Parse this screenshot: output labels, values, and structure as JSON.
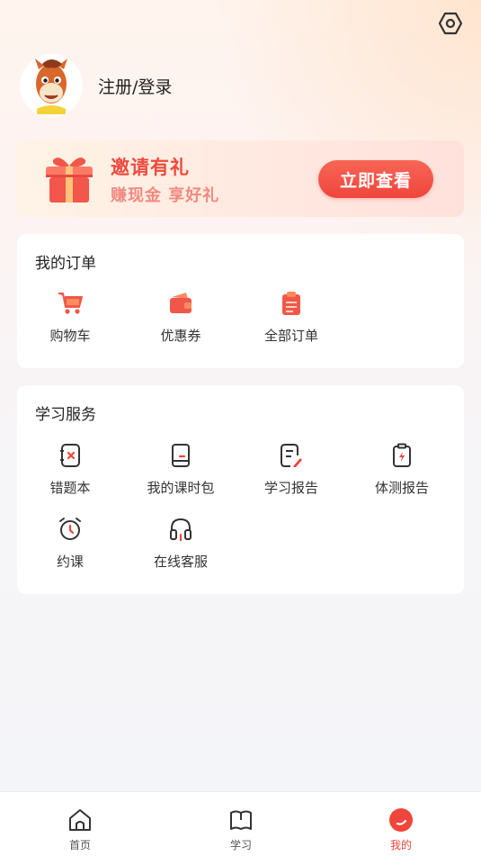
{
  "header": {
    "settings_icon": "settings-hexagon-icon"
  },
  "profile": {
    "login_label": "注册/登录",
    "avatar_icon": "horse-mascot-avatar"
  },
  "banner": {
    "title": "邀请有礼",
    "subtitle": "赚现金 享好礼",
    "cta_label": "立即查看",
    "icon": "gift-box-icon",
    "accent": "#ef4a3e"
  },
  "orders": {
    "title": "我的订单",
    "items": [
      {
        "label": "购物车",
        "icon": "shopping-cart-icon"
      },
      {
        "label": "优惠券",
        "icon": "coupon-wallet-icon"
      },
      {
        "label": "全部订单",
        "icon": "order-list-icon"
      }
    ]
  },
  "services": {
    "title": "学习服务",
    "items": [
      {
        "label": "错题本",
        "icon": "mistake-book-icon"
      },
      {
        "label": "我的课时包",
        "icon": "lesson-package-icon"
      },
      {
        "label": "学习报告",
        "icon": "study-report-icon"
      },
      {
        "label": "体测报告",
        "icon": "fitness-report-icon"
      },
      {
        "label": "约课",
        "icon": "alarm-clock-icon"
      },
      {
        "label": "在线客服",
        "icon": "headset-icon"
      }
    ]
  },
  "tabbar": {
    "active_color": "#ef453a",
    "tabs": [
      {
        "label": "首页",
        "icon": "home-icon"
      },
      {
        "label": "学习",
        "icon": "book-icon"
      },
      {
        "label": "我的",
        "icon": "profile-icon"
      }
    ]
  }
}
